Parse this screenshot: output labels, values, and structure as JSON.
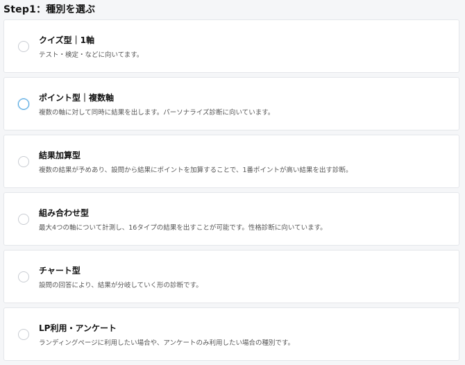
{
  "step": {
    "title": "Step1：種別を選ぶ"
  },
  "options": [
    {
      "title": "クイズ型｜1軸",
      "description": "テスト・検定・などに向いてます。",
      "focused": false
    },
    {
      "title": "ポイント型｜複数軸",
      "description": "複数の軸に対して同時に結果を出します。パーソナライズ診断に向いています。",
      "focused": true
    },
    {
      "title": "結果加算型",
      "description": "複数の結果が予めあり、設問から結果にポイントを加算することで、1番ポイントが高い結果を出す診断。",
      "focused": false
    },
    {
      "title": "組み合わせ型",
      "description": "最大4つの軸について計測し、16タイプの結果を出すことが可能です。性格診断に向いています。",
      "focused": false
    },
    {
      "title": "チャート型",
      "description": "設問の回答により、結果が分岐していく形の診断です。",
      "focused": false
    },
    {
      "title": "LP利用・アンケート",
      "description": "ランディングページに利用したい場合や、アンケートのみ利用したい場合の種別です。",
      "focused": false
    }
  ],
  "colors": {
    "focus_ring": "#4aa3df",
    "card_bg": "#ffffff",
    "page_bg": "#f5f6f8"
  }
}
